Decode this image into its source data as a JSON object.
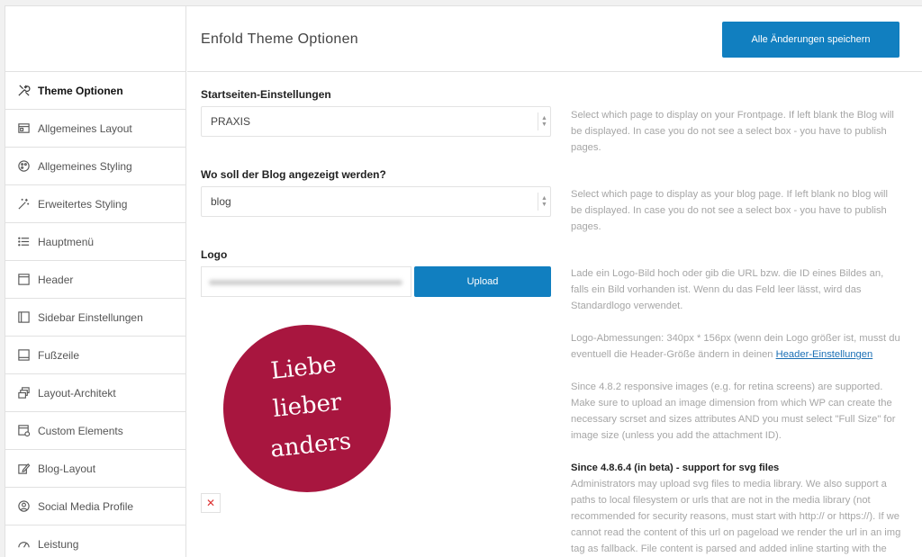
{
  "header": {
    "title": "Enfold Theme Optionen",
    "save_label": "Alle Änderungen speichern"
  },
  "sidebar": {
    "items": [
      {
        "label": "Theme Optionen",
        "icon": "tools-icon",
        "active": true
      },
      {
        "label": "Allgemeines Layout",
        "icon": "layout-icon"
      },
      {
        "label": "Allgemeines Styling",
        "icon": "palette-icon"
      },
      {
        "label": "Erweitertes Styling",
        "icon": "magic-wand-icon"
      },
      {
        "label": "Hauptmenü",
        "icon": "menu-list-icon"
      },
      {
        "label": "Header",
        "icon": "header-icon"
      },
      {
        "label": "Sidebar Einstellungen",
        "icon": "sidebar-icon"
      },
      {
        "label": "Fußzeile",
        "icon": "footer-icon"
      },
      {
        "label": "Layout-Architekt",
        "icon": "layers-icon"
      },
      {
        "label": "Custom Elements",
        "icon": "custom-elements-icon"
      },
      {
        "label": "Blog-Layout",
        "icon": "blog-edit-icon"
      },
      {
        "label": "Social Media Profile",
        "icon": "social-icon"
      },
      {
        "label": "Leistung",
        "icon": "gauge-icon"
      }
    ]
  },
  "frontpage": {
    "label": "Startseiten-Einstellungen",
    "value": "PRAXIS",
    "description": "Select which page to display on your Frontpage. If left blank the Blog will be displayed. In case you do not see a select box - you have to publish pages."
  },
  "blogpage": {
    "label": "Wo soll der Blog angezeigt werden?",
    "value": "blog",
    "description": "Select which page to display as your blog page. If left blank no blog will be displayed. In case you do not see a select box - you have to publish pages."
  },
  "logo": {
    "label": "Logo",
    "upload_label": "Upload",
    "remove_symbol": "✕",
    "preview_lines": [
      "Liebe",
      "lieber",
      "anders"
    ],
    "preview_color": "#a8163f",
    "desc1": "Lade ein Logo-Bild hoch oder gib die URL bzw. die ID eines Bildes an, falls ein Bild vorhanden ist. Wenn du das Feld leer lässt, wird das Standardlogo verwendet.",
    "desc2_text": "Logo-Abmessungen: 340px * 156px (wenn dein Logo größer ist, musst du eventuell die Header-Größe ändern in deinen ",
    "desc2_link": "Header-Einstellungen",
    "desc3": "Since 4.8.2 responsive images (e.g. for retina screens) are supported. Make sure to upload an image dimension from which WP can create the necessary scrset and sizes attributes AND you must select \"Full Size\" for image size (unless you add the attachment ID).",
    "svg_heading": "Since 4.8.6.4 (in beta) - support for svg files",
    "svg_text": "Administrators may upload svg files to media library. We also support a paths to local filesystem or urls that are not in the media library (not recommended for security reasons, must start with http:// or https://). If we cannot read the content of this url on pageload we render the url in an img tag as fallback. File content is parsed and added inline starting with the first"
  },
  "colors": {
    "accent": "#117fc0",
    "link": "#1a6fb5"
  }
}
